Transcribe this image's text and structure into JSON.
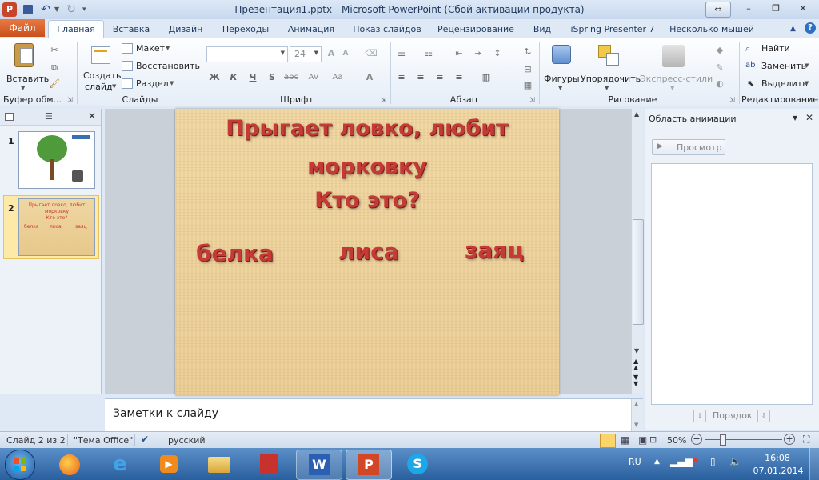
{
  "window": {
    "title": "Презентация1.pptx - Microsoft PowerPoint (Сбой активации продукта)",
    "controls": {
      "restore": "⇔",
      "minimize": "–",
      "maximize": "❐",
      "close": "✕"
    }
  },
  "tabs": {
    "file": "Файл",
    "items": [
      "Главная",
      "Вставка",
      "Дизайн",
      "Переходы",
      "Анимация",
      "Показ слайдов",
      "Рецензирование",
      "Вид",
      "iSpring Presenter 7",
      "Несколько мышей"
    ]
  },
  "ribbon": {
    "clipboard": {
      "paste": "Вставить",
      "label": "Буфер обм..."
    },
    "slides": {
      "new_slide_line1": "Создать",
      "new_slide_line2": "слайд",
      "layout": "Макет",
      "reset": "Восстановить",
      "section": "Раздел",
      "label": "Слайды"
    },
    "font": {
      "size": "24",
      "bold": "Ж",
      "italic": "К",
      "underline": "Ч",
      "shadow": "S",
      "strike": "abc",
      "spacing": "AV",
      "case": "Aa",
      "color": "A",
      "label": "Шрифт"
    },
    "paragraph": {
      "label": "Абзац"
    },
    "drawing": {
      "shapes": "Фигуры",
      "arrange": "Упорядочить",
      "quick_styles": "Экспресс-стили",
      "label": "Рисование"
    },
    "editing": {
      "find": "Найти",
      "replace": "Заменить",
      "select": "Выделить",
      "label": "Редактирование"
    }
  },
  "thumbnails": [
    {
      "number": "1"
    },
    {
      "number": "2",
      "mini_lines": [
        "Прыгает ловко, любит",
        "морковку",
        "Кто это?"
      ],
      "mini_words": [
        "белка",
        "лиса",
        "заяц"
      ]
    }
  ],
  "slide": {
    "question_line1": "Прыгает ловко, любит",
    "question_line2": "морковку",
    "question_line3": "Кто это?",
    "answer1": "белка",
    "answer2": "лиса",
    "answer3": "заяц"
  },
  "notes": {
    "placeholder": "Заметки к слайду"
  },
  "animation_pane": {
    "title": "Область анимации",
    "preview": "Просмотр",
    "order": "Порядок"
  },
  "statusbar": {
    "slide_info": "Слайд 2 из 2",
    "theme": "\"Тема Office\"",
    "language": "русский",
    "zoom": "50%"
  },
  "taskbar": {
    "language": "RU",
    "time": "16:08",
    "date": "07.01.2014"
  },
  "colors": {
    "accent": "#c53a35",
    "file_tab": "#d0581f",
    "taskbar": "#2a5f9e"
  }
}
